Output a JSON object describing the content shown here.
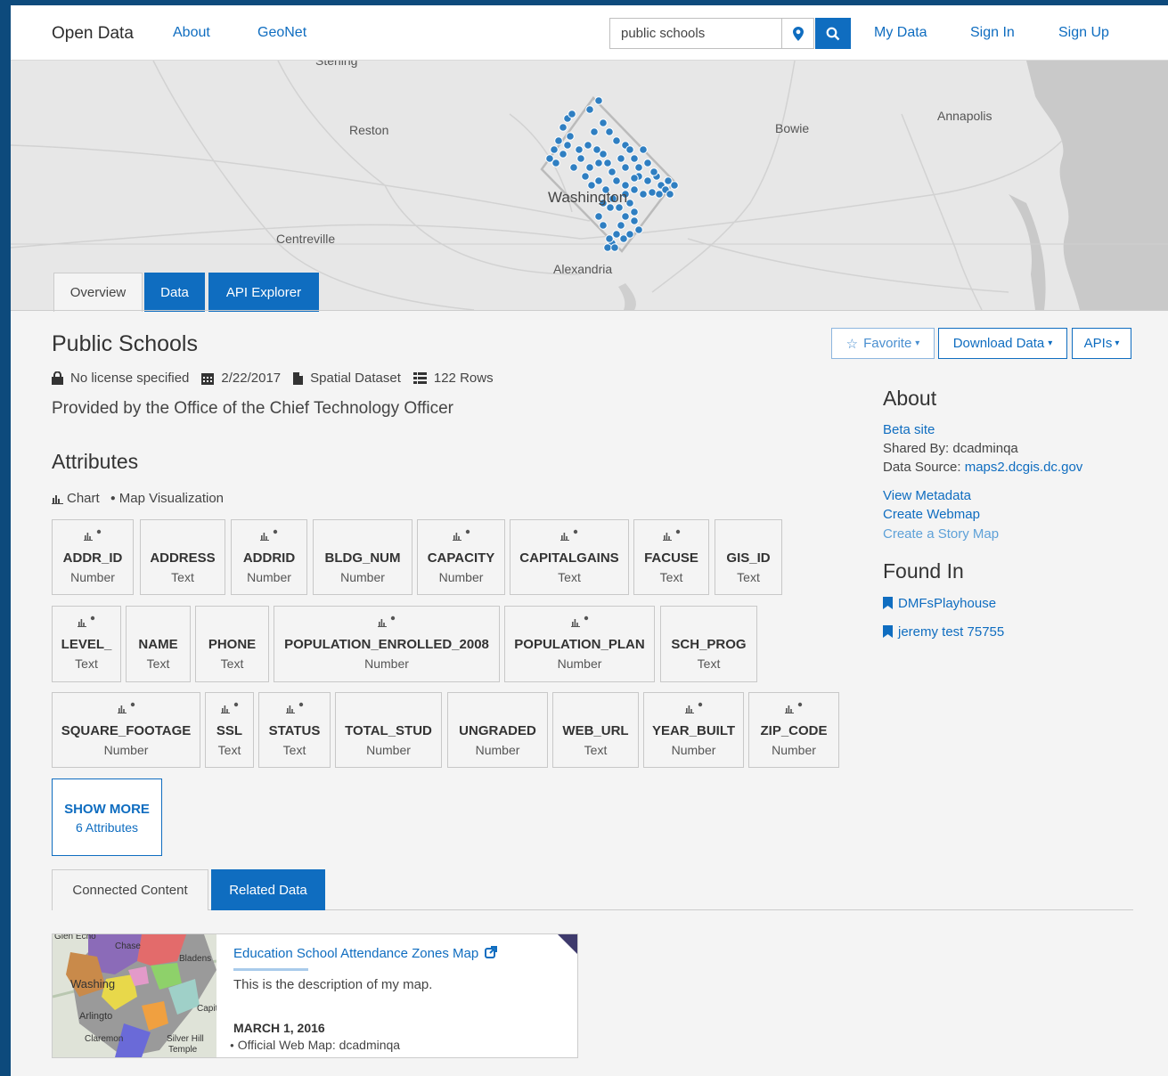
{
  "nav": {
    "brand": "Open Data",
    "links": [
      "About",
      "GeoNet"
    ],
    "search_value": "public schools",
    "right_links": [
      "My Data",
      "Sign In",
      "Sign Up"
    ]
  },
  "map": {
    "labels": [
      "Sterling",
      "Reston",
      "Bowie",
      "Annapolis",
      "Washington",
      "Centreville",
      "Alexandria"
    ],
    "point_color": "#2f7fc2"
  },
  "tabs_top": [
    "Overview",
    "Data",
    "API Explorer"
  ],
  "dataset": {
    "title": "Public Schools",
    "license": "No license specified",
    "date": "2/22/2017",
    "type": "Spatial Dataset",
    "rows": "122 Rows",
    "provided_by": "Provided by the Office of the Chief Technology Officer"
  },
  "actions": {
    "favorite": "Favorite",
    "download": "Download Data",
    "apis": "APIs"
  },
  "attributes": {
    "heading": "Attributes",
    "legend_chart": "Chart",
    "legend_map": "Map Visualization",
    "items": [
      {
        "name": "ADDR_ID",
        "type": "Number"
      },
      {
        "name": "ADDRESS",
        "type": "Text"
      },
      {
        "name": "ADDRID",
        "type": "Number"
      },
      {
        "name": "BLDG_NUM",
        "type": "Number"
      },
      {
        "name": "CAPACITY",
        "type": "Number"
      },
      {
        "name": "CAPITALGAINS",
        "type": "Text"
      },
      {
        "name": "FACUSE",
        "type": "Text"
      },
      {
        "name": "GIS_ID",
        "type": "Text"
      },
      {
        "name": "LEVEL_",
        "type": "Text"
      },
      {
        "name": "NAME",
        "type": "Text"
      },
      {
        "name": "PHONE",
        "type": "Text"
      },
      {
        "name": "POPULATION_ENROLLED_2008",
        "type": "Number"
      },
      {
        "name": "POPULATION_PLAN",
        "type": "Number"
      },
      {
        "name": "SCH_PROG",
        "type": "Text"
      },
      {
        "name": "SQUARE_FOOTAGE",
        "type": "Number"
      },
      {
        "name": "SSL",
        "type": "Text"
      },
      {
        "name": "STATUS",
        "type": "Text"
      },
      {
        "name": "TOTAL_STUD",
        "type": "Number"
      },
      {
        "name": "UNGRADED",
        "type": "Number"
      },
      {
        "name": "WEB_URL",
        "type": "Text"
      },
      {
        "name": "YEAR_BUILT",
        "type": "Number"
      },
      {
        "name": "ZIP_CODE",
        "type": "Number"
      }
    ],
    "show_more": "SHOW MORE",
    "show_more_count": "6 Attributes"
  },
  "tabs_bottom": [
    "Connected Content",
    "Related Data"
  ],
  "related": {
    "title": "Education School Attendance Zones Map",
    "description": "This is the description of my map.",
    "date": "MARCH 1, 2016",
    "by": "Official Web Map: dcadminqa",
    "thumb_labels": [
      "Glen Echo",
      "Chase",
      "Bladens",
      "Washing",
      "Arlingto",
      "Claremon",
      "Capit",
      "Silver Hill",
      "Temple"
    ]
  },
  "about": {
    "heading": "About",
    "beta": "Beta site",
    "shared_by": "Shared By: dcadminqa",
    "source_label": "Data Source: ",
    "source_link": "maps2.dcgis.dc.gov",
    "view_metadata": "View Metadata",
    "create_webmap": "Create Webmap",
    "create_story": "Create a Story Map"
  },
  "found_in": {
    "heading": "Found In",
    "items": [
      "DMFsPlayhouse",
      "jeremy test 75755"
    ]
  }
}
